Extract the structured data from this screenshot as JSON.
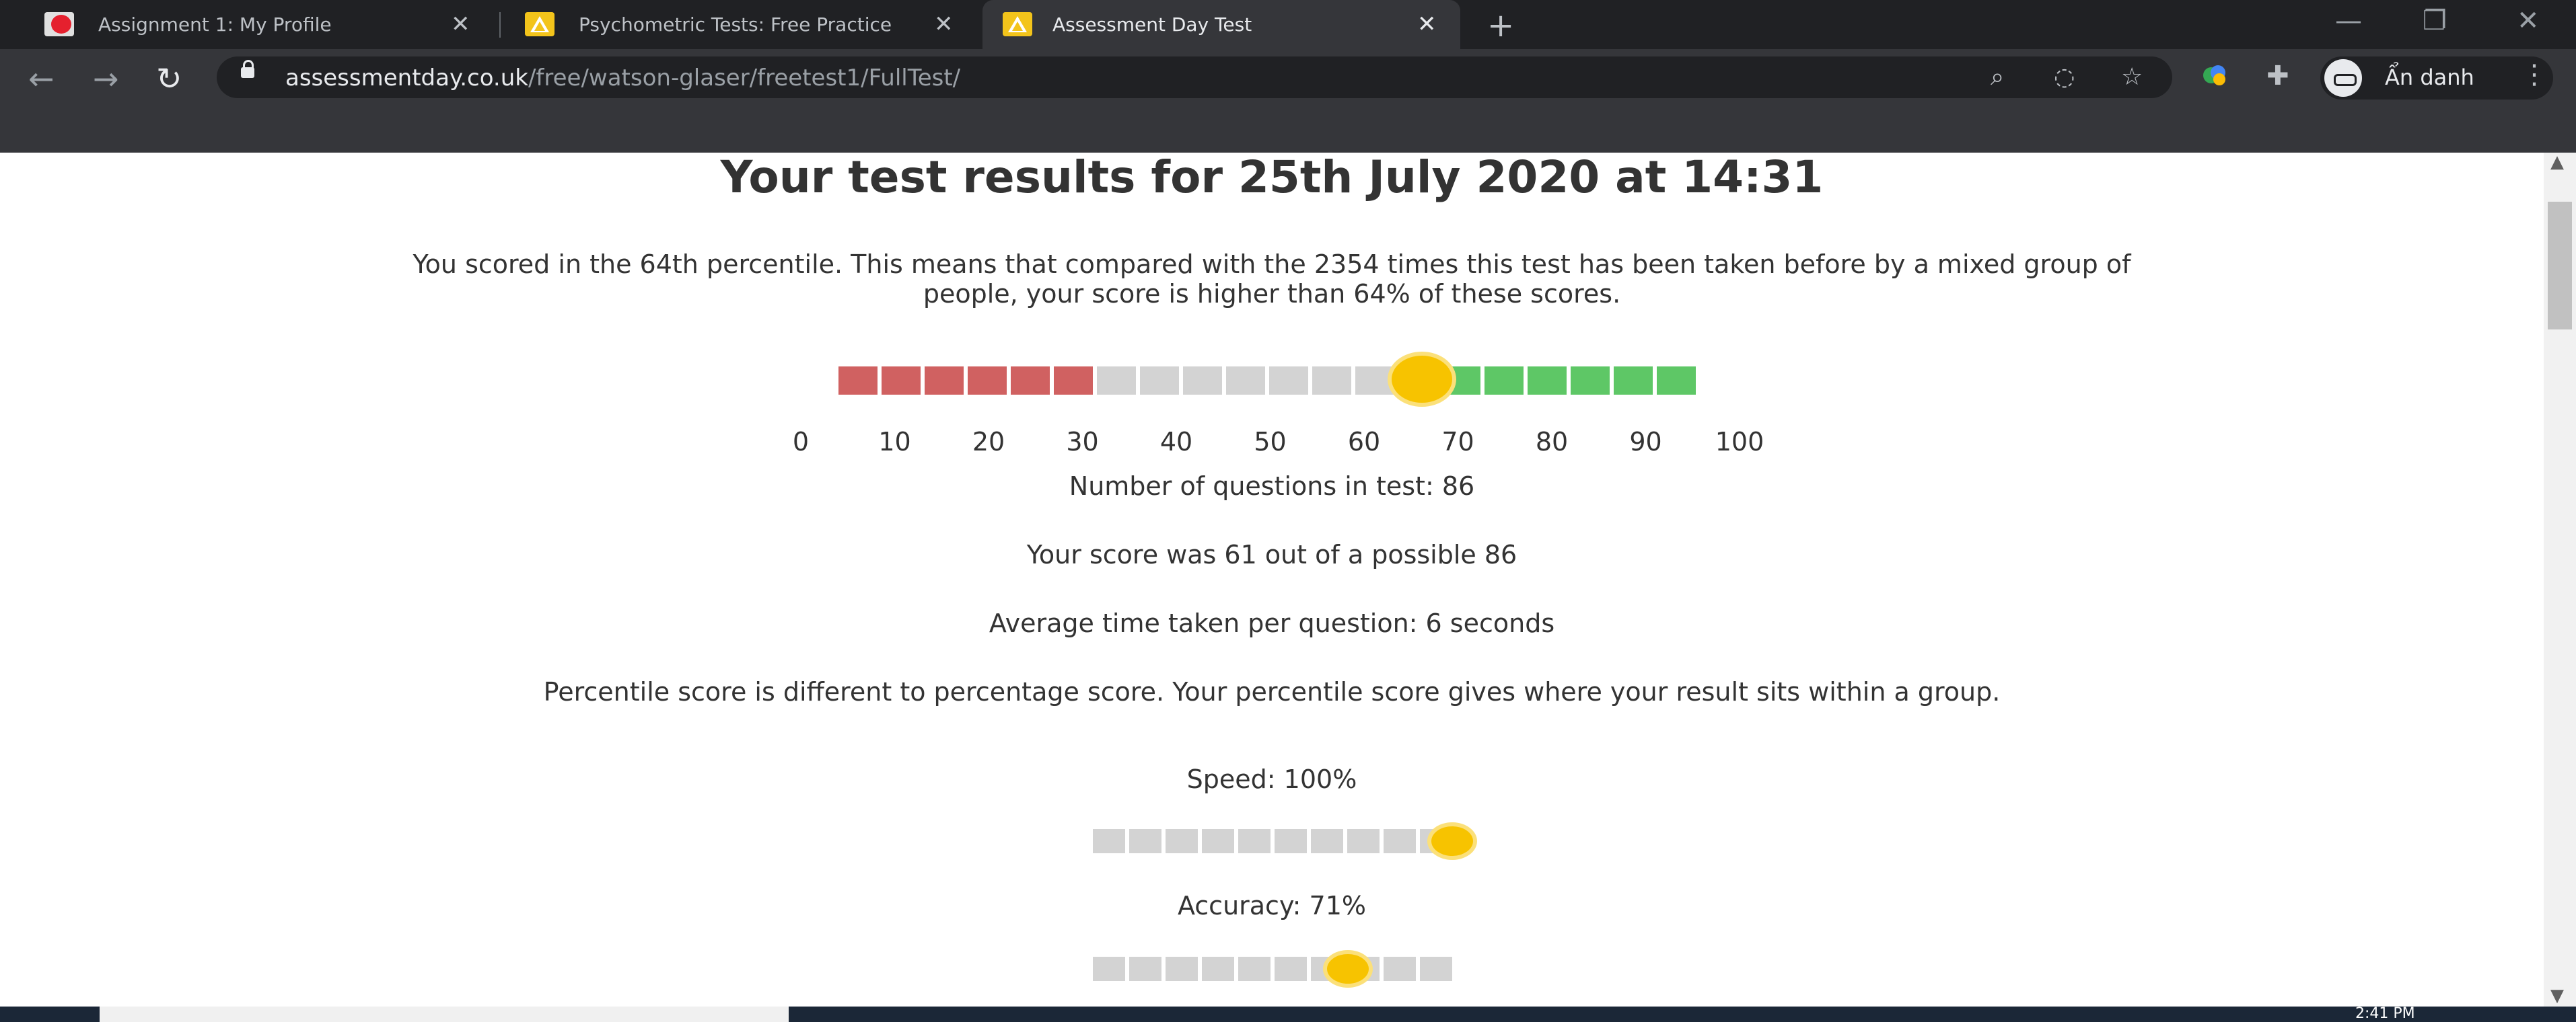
{
  "browser": {
    "tabs": [
      {
        "title": "Assignment 1: My Profile",
        "favicon": "red-box-icon"
      },
      {
        "title": "Psychometric Tests: Free Practice",
        "favicon": "assessmentday-logo-icon"
      },
      {
        "title": "Assessment Day Test",
        "favicon": "assessmentday-logo-icon",
        "active": true
      }
    ],
    "url_domain": "assessmentday.co.uk",
    "url_path": "/free/watson-glaser/freetest1/FullTest/",
    "profile_label": "Ẩn danh"
  },
  "page": {
    "title": "Your test results for 25th July 2020 at 14:31",
    "percentile_line1": "You scored in the 64th percentile. This means that compared with the 2354 times this test has been taken before by a mixed group of",
    "percentile_line2": "people, your score is higher than 64% of these scores.",
    "percentile": 64,
    "scale_ticks": [
      "0",
      "10",
      "20",
      "30",
      "40",
      "50",
      "60",
      "70",
      "80",
      "90",
      "100"
    ],
    "questions_count": "Number of questions in test: 86",
    "score_text": "Your score was 61 out of a possible 86",
    "avg_time": "Average time taken per question: 6 seconds",
    "percentile_note": "Percentile score is different to percentage score. Your percentile score gives where your result sits within a group.",
    "speed_label": "Speed: 100%",
    "speed_value": 100,
    "accuracy_label": "Accuracy: 71%",
    "accuracy_value": 71
  },
  "taskbar": {
    "clock": "2:41 PM"
  }
}
